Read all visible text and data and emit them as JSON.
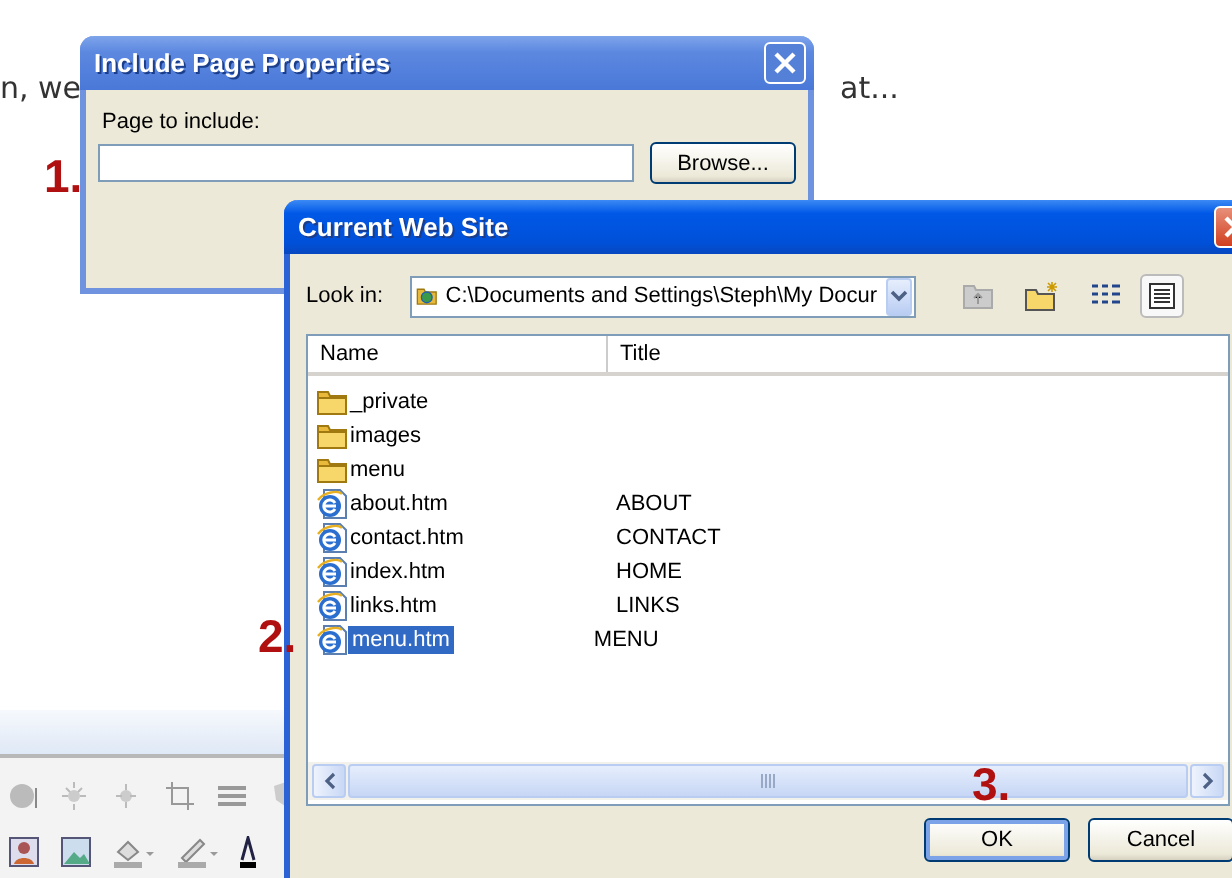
{
  "document": {
    "text_left": "n, we",
    "text_right": "at..."
  },
  "include_dialog": {
    "title": "Include Page Properties",
    "active": false,
    "field_label": "Page to include:",
    "browse_button": "Browse..."
  },
  "site_dialog": {
    "title": "Current Web Site",
    "active": true,
    "look_in_label": "Look in:",
    "look_in_value": "C:\\Documents and Settings\\Steph\\My Docur",
    "columns": [
      "Name",
      "Title"
    ],
    "files": [
      {
        "kind": "folder",
        "name": "_private",
        "selected": false
      },
      {
        "kind": "folder",
        "name": "images",
        "selected": false
      },
      {
        "kind": "folder",
        "name": "menu",
        "selected": false
      },
      {
        "kind": "page",
        "name": "about.htm",
        "title": "ABOUT",
        "selected": false
      },
      {
        "kind": "page",
        "name": "contact.htm",
        "title": "CONTACT",
        "selected": false
      },
      {
        "kind": "page",
        "name": "index.htm",
        "title": "HOME",
        "selected": false
      },
      {
        "kind": "page",
        "name": "links.htm",
        "title": "LINKS",
        "selected": false
      },
      {
        "kind": "page",
        "name": "menu.htm",
        "title": "MENU",
        "selected": true
      }
    ],
    "buttons": [
      {
        "label": "OK",
        "default": true
      },
      {
        "label": "Cancel",
        "default": false
      }
    ]
  },
  "annotations": [
    {
      "label": "1."
    },
    {
      "label": "2."
    },
    {
      "label": "3."
    }
  ]
}
